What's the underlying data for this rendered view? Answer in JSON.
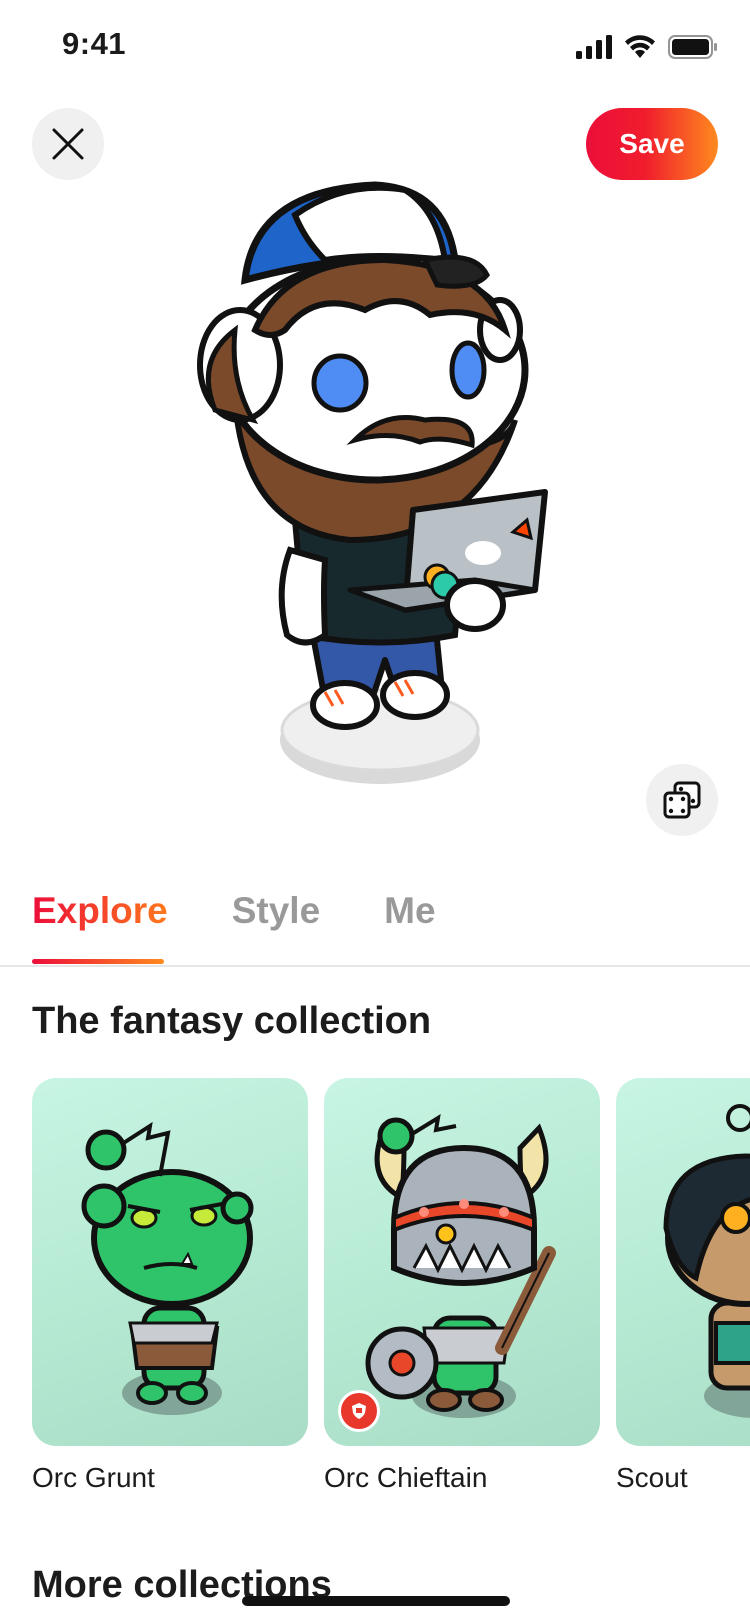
{
  "status_bar": {
    "time": "9:41"
  },
  "header": {
    "save_label": "Save"
  },
  "tabs": [
    {
      "label": "Explore",
      "active": true
    },
    {
      "label": "Style",
      "active": false
    },
    {
      "label": "Me",
      "active": false
    }
  ],
  "fantasy_section": {
    "title": "The fantasy collection",
    "items": [
      {
        "name": "Orc Grunt",
        "premium": false
      },
      {
        "name": "Orc Chieftain",
        "premium": true
      },
      {
        "name": "Scout",
        "premium": false
      }
    ]
  },
  "more_section": {
    "title": "More collections"
  },
  "colors": {
    "accent_start": "#ec0e3a",
    "accent_end": "#ff8a1f",
    "card_bg": "#b6ead3",
    "inactive_tab": "#999999"
  }
}
